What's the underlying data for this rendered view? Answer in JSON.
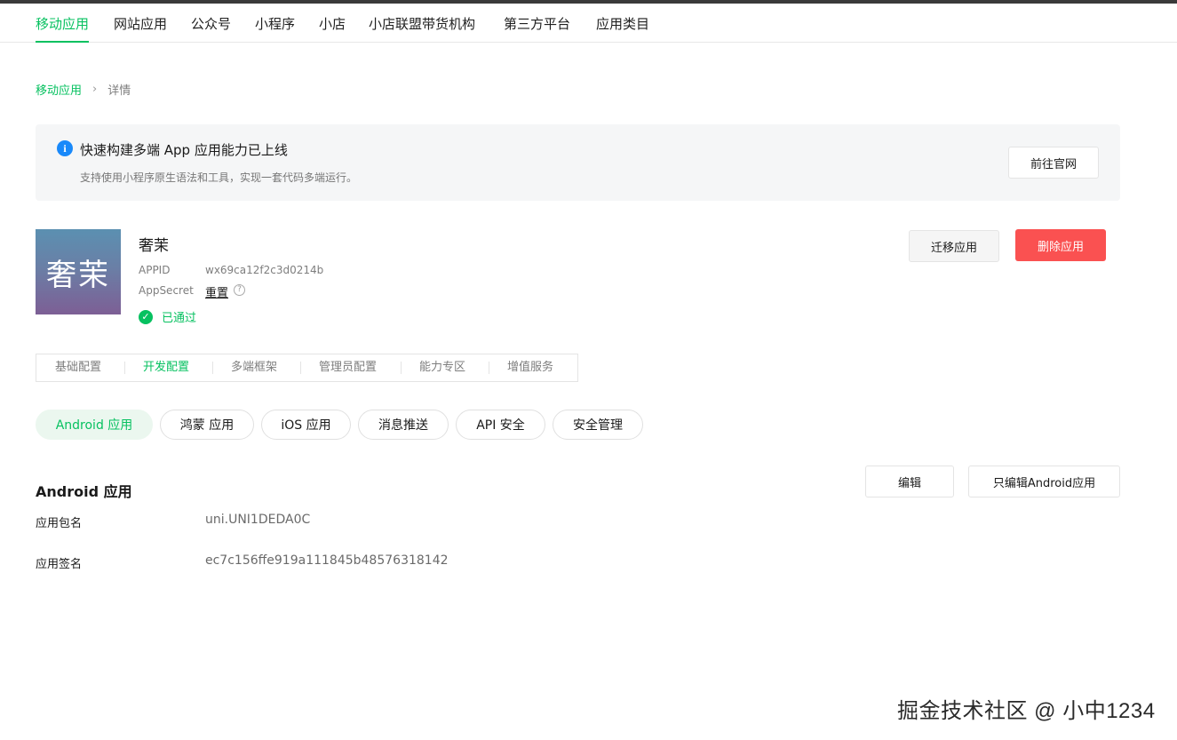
{
  "nav": {
    "items": [
      {
        "label": "移动应用"
      },
      {
        "label": "网站应用"
      },
      {
        "label": "公众号"
      },
      {
        "label": "小程序"
      },
      {
        "label": "小店"
      },
      {
        "label": "小店联盟带货机构"
      },
      {
        "label": "第三方平台"
      },
      {
        "label": "应用类目"
      }
    ],
    "active": "移动应用"
  },
  "breadcrumb": {
    "root": "移动应用",
    "separator": "›",
    "current": "详情"
  },
  "notice": {
    "icon": "info-icon",
    "title": "快速构建多端 App 应用能力已上线",
    "description": "支持使用小程序原生语法和工具，实现一套代码多端运行。",
    "button_label": "前往官网"
  },
  "app": {
    "avatar_text": "奢茉",
    "name": "奢茉",
    "appid_label": "APPID",
    "appid_value": "wx69ca12f2c3d0214b",
    "appsecret_label": "AppSecret",
    "appsecret_action": "重置",
    "status": "已通过"
  },
  "actions": {
    "migrate_label": "迁移应用",
    "delete_label": "删除应用"
  },
  "subtabs": {
    "items": [
      {
        "label": "基础配置"
      },
      {
        "label": "开发配置"
      },
      {
        "label": "多端框架"
      },
      {
        "label": "管理员配置"
      },
      {
        "label": "能力专区"
      },
      {
        "label": "增值服务"
      }
    ],
    "active": "开发配置"
  },
  "pills": {
    "items": [
      {
        "label": "Android 应用"
      },
      {
        "label": "鸿蒙 应用"
      },
      {
        "label": "iOS 应用"
      },
      {
        "label": "消息推送"
      },
      {
        "label": "API 安全"
      },
      {
        "label": "安全管理"
      }
    ],
    "active": "Android 应用"
  },
  "section": {
    "title": "Android 应用",
    "edit_label": "编辑",
    "edit_android_label": "只编辑Android应用",
    "rows": [
      {
        "label": "应用包名",
        "value": "uni.UNI1DEDA0C"
      },
      {
        "label": "应用签名",
        "value": "ec7c156ffe919a111845b48576318142"
      }
    ]
  },
  "watermark": "掘金技术社区 @ 小中1234",
  "colors": {
    "accent": "#07c160",
    "danger": "#fa5151",
    "info": "#1989fa"
  }
}
